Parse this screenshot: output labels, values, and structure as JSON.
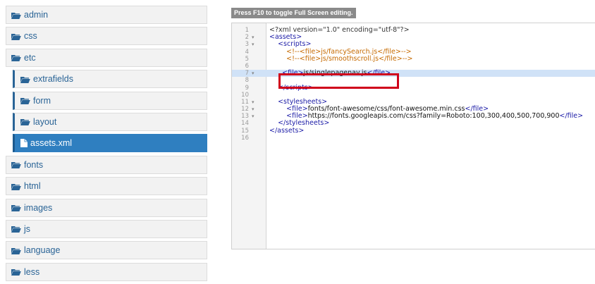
{
  "tree": {
    "items": [
      {
        "label": "admin",
        "type": "folder",
        "child": false,
        "active": false
      },
      {
        "label": "css",
        "type": "folder",
        "child": false,
        "active": false
      },
      {
        "label": "etc",
        "type": "folder",
        "child": false,
        "active": false
      },
      {
        "label": "extrafields",
        "type": "folder",
        "child": true,
        "active": false
      },
      {
        "label": "form",
        "type": "folder",
        "child": true,
        "active": false
      },
      {
        "label": "layout",
        "type": "folder",
        "child": true,
        "active": false
      },
      {
        "label": "assets.xml",
        "type": "file",
        "child": true,
        "active": true
      },
      {
        "label": "fonts",
        "type": "folder",
        "child": false,
        "active": false
      },
      {
        "label": "html",
        "type": "folder",
        "child": false,
        "active": false
      },
      {
        "label": "images",
        "type": "folder",
        "child": false,
        "active": false
      },
      {
        "label": "js",
        "type": "folder",
        "child": false,
        "active": false
      },
      {
        "label": "language",
        "type": "folder",
        "child": false,
        "active": false
      },
      {
        "label": "less",
        "type": "folder",
        "child": false,
        "active": false
      }
    ]
  },
  "editor": {
    "hint": "Press F10 to toggle Full Screen editing.",
    "lines": [
      {
        "num": "1",
        "fold": "",
        "code": "<?xml version=\"1.0\" encoding=\"utf-8\"?>",
        "kind": "pi",
        "hl": false
      },
      {
        "num": "2",
        "fold": "▾",
        "code": "<assets>",
        "kind": "tag",
        "hl": false
      },
      {
        "num": "3",
        "fold": "▾",
        "code": "    <scripts>",
        "kind": "tag",
        "hl": false
      },
      {
        "num": "4",
        "fold": "",
        "code": "        <!--<file>js/fancySearch.js</file>-->",
        "kind": "cmt",
        "hl": false
      },
      {
        "num": "5",
        "fold": "",
        "code": "        <!--<file>js/smoothscroll.js</file>-->",
        "kind": "cmt",
        "hl": false
      },
      {
        "num": "6",
        "fold": "",
        "code": "",
        "kind": "txt",
        "hl": false
      },
      {
        "num": "7",
        "fold": "▾",
        "code": "      <file>js/singlepagenav.js</file>",
        "kind": "file",
        "hl": true
      },
      {
        "num": "8",
        "fold": "",
        "code": "",
        "kind": "txt",
        "hl": false
      },
      {
        "num": "9",
        "fold": "",
        "code": "    </scripts>",
        "kind": "tag",
        "hl": false
      },
      {
        "num": "10",
        "fold": "",
        "code": "",
        "kind": "txt",
        "hl": false
      },
      {
        "num": "11",
        "fold": "▾",
        "code": "    <stylesheets>",
        "kind": "tag",
        "hl": false
      },
      {
        "num": "12",
        "fold": "▾",
        "code": "        <file>fonts/font-awesome/css/font-awesome.min.css</file>",
        "kind": "file",
        "hl": false
      },
      {
        "num": "13",
        "fold": "▾",
        "code": "        <file>https://fonts.googleapis.com/css?family=Roboto:100,300,400,500,700,900</file>",
        "kind": "file",
        "hl": false
      },
      {
        "num": "14",
        "fold": "",
        "code": "    </stylesheets>",
        "kind": "tag",
        "hl": false
      },
      {
        "num": "15",
        "fold": "",
        "code": "</assets>",
        "kind": "tag",
        "hl": false
      },
      {
        "num": "16",
        "fold": "",
        "code": "",
        "kind": "txt",
        "hl": false
      }
    ]
  },
  "colors": {
    "accent": "#2f7fc0",
    "link": "#2a6496",
    "tag": "#1a1aa6",
    "comment": "#c66a00",
    "highlight": "#d0e2f7",
    "selection_box": "#d0021b"
  },
  "icons": {
    "folder": "folder-open-icon",
    "file": "file-icon"
  }
}
